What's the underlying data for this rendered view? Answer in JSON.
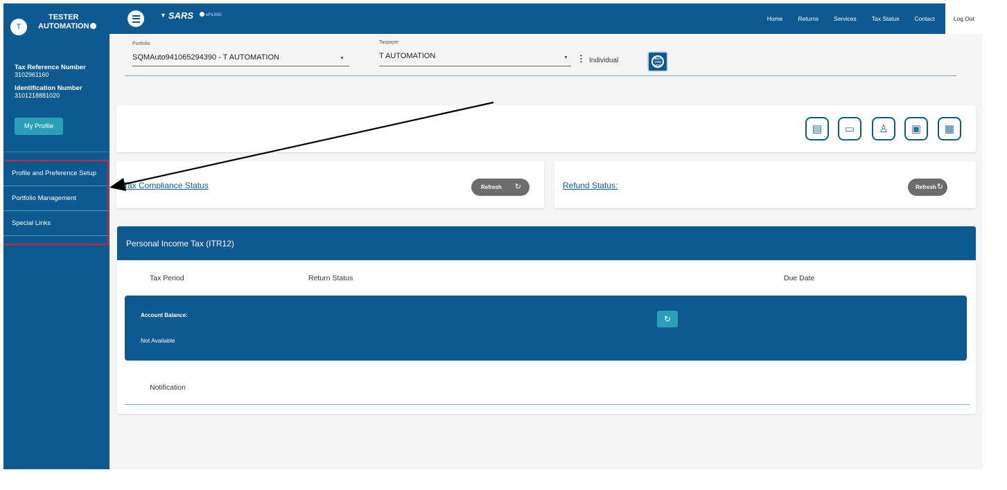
{
  "user": {
    "initial": "T",
    "first_name": "TESTER",
    "last_name": "AUTOMATION",
    "tax_ref_label": "Tax Reference Number",
    "tax_ref_value": "3102961160",
    "id_label": "Identification Number",
    "id_value": "3101218881020",
    "profile_button": "My Profile"
  },
  "sidebar": {
    "items": [
      {
        "label": "Profile and Preference Setup"
      },
      {
        "label": "Portfolio Management"
      },
      {
        "label": "Special Links"
      }
    ]
  },
  "header": {
    "logo_text": "SARS",
    "efiling_text": "eFILING",
    "nav": [
      "Home",
      "Returns",
      "Services",
      "Tax Status",
      "Contact",
      "Log Out"
    ]
  },
  "portfolio": {
    "portfolio_label": "Portfolio",
    "portfolio_value": "SQMAuto941065294390 - T AUTOMATION",
    "taxpayer_label": "Taxpayer",
    "taxpayer_value": "T AUTOMATION",
    "type": "Individual",
    "help_badge": "HELP YOU NOW"
  },
  "quick_icons": [
    "tax-return-icon",
    "document-icon",
    "search-person-icon",
    "book-icon",
    "calendar-icon"
  ],
  "compliance": {
    "title": "Tax Compliance Status",
    "refresh_label": "Refresh"
  },
  "refund": {
    "title": "Refund Status:",
    "refresh_label": "Refresh"
  },
  "itr12": {
    "title": "Personal Income Tax (ITR12)",
    "columns": [
      "Tax Period",
      "Return Status",
      "Due Date"
    ],
    "balance_label": "Account Balance:",
    "balance_value": "Not Available",
    "notification": "Notification"
  },
  "colors": {
    "primary": "#0d5a91",
    "accent": "#2aa0b8",
    "highlight_border": "#d0262c"
  }
}
